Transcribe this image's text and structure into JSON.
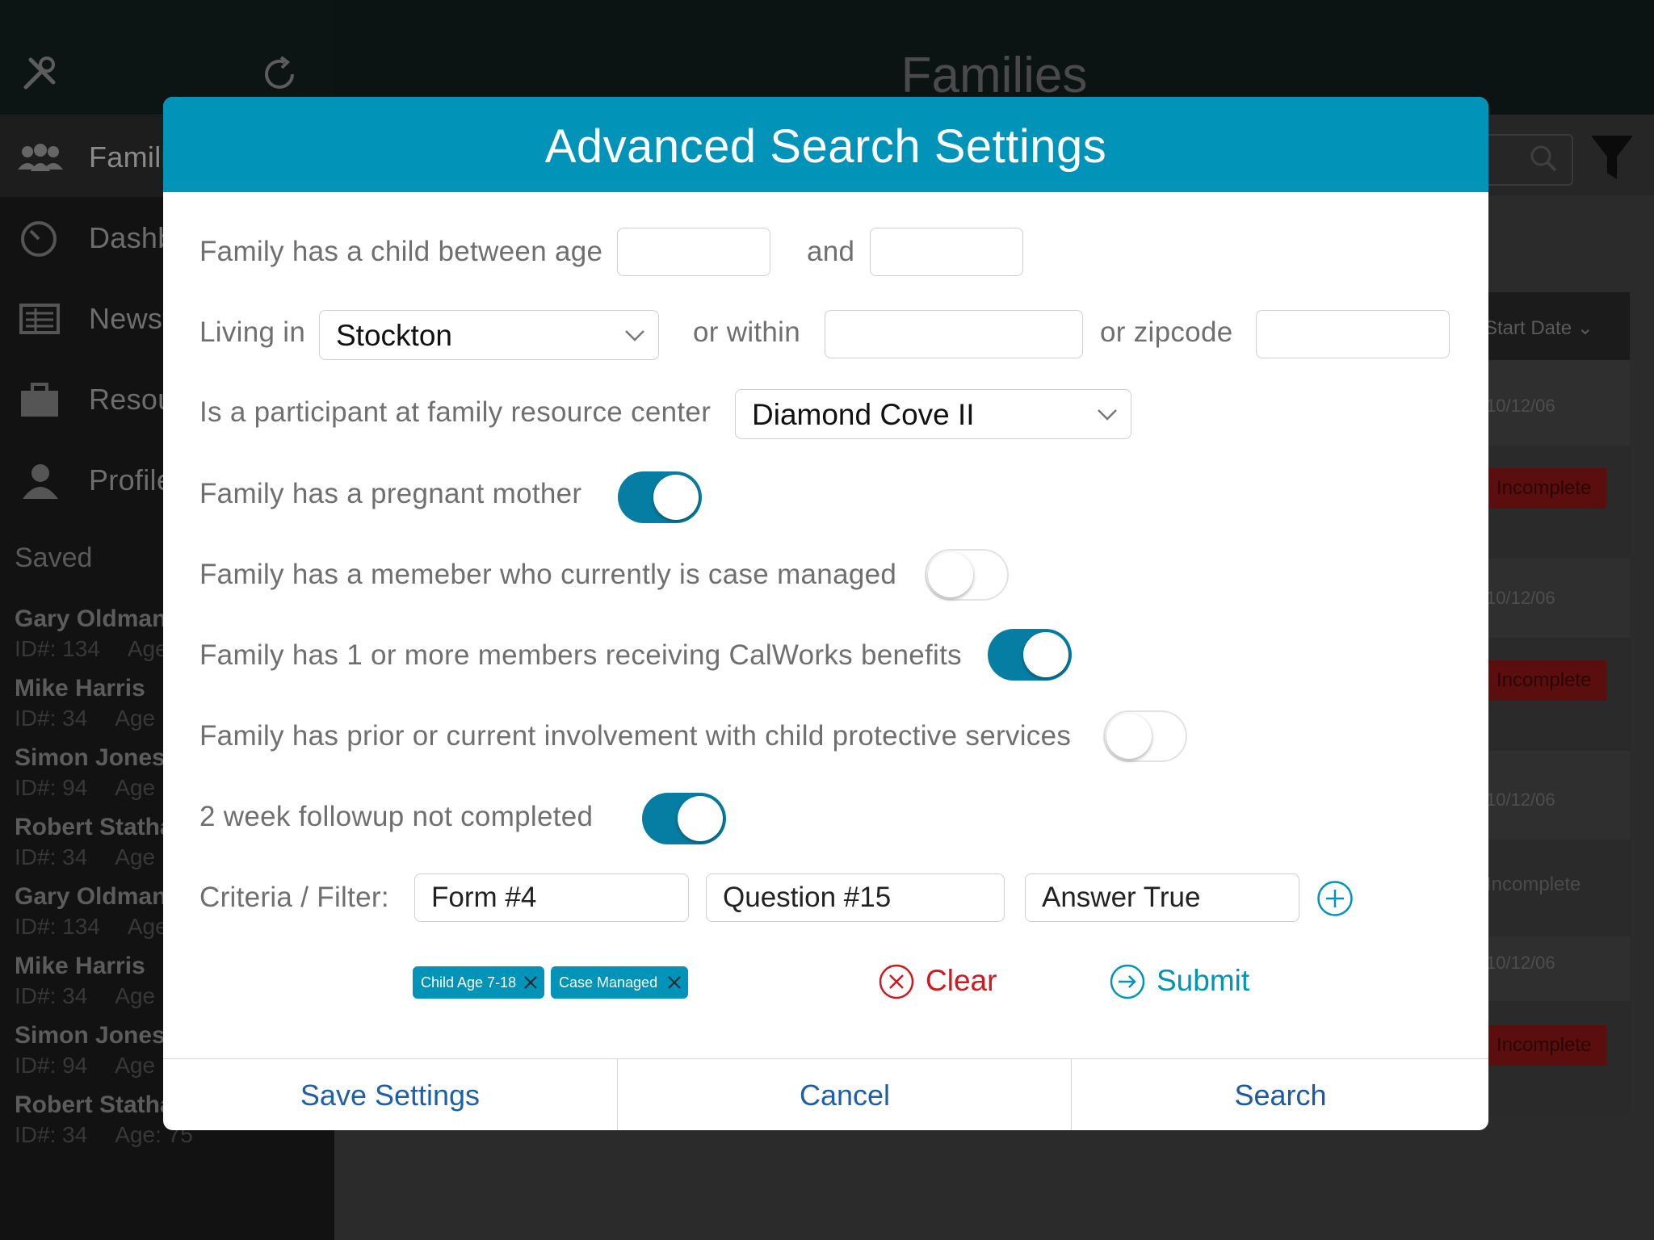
{
  "background": {
    "header_title": "Families",
    "sidebar": {
      "nav": [
        {
          "label": "Families",
          "icon": "people-icon"
        },
        {
          "label": "Dashboard",
          "icon": "dashboard-icon"
        },
        {
          "label": "Newsfeed",
          "icon": "news-icon"
        },
        {
          "label": "Resources",
          "icon": "briefcase-icon"
        },
        {
          "label": "Profile",
          "icon": "person-icon"
        }
      ],
      "saved_heading": "Saved",
      "saved": [
        {
          "name": "Gary Oldman",
          "id": "ID#: 134",
          "age": "Age"
        },
        {
          "name": "Mike Harris",
          "id": "ID#: 34",
          "age": "Age"
        },
        {
          "name": "Simon Jones",
          "id": "ID#: 94",
          "age": "Age"
        },
        {
          "name": "Robert Statham",
          "id": "ID#: 34",
          "age": "Age"
        },
        {
          "name": "Gary Oldman",
          "id": "ID#: 134",
          "age": "Age"
        },
        {
          "name": "Mike Harris",
          "id": "ID#: 34",
          "age": "Age"
        },
        {
          "name": "Simon Jones",
          "id": "ID#: 94",
          "age": "Age"
        },
        {
          "name": "Robert Statham",
          "id": "ID#: 34",
          "age": "Age: 75"
        }
      ]
    },
    "table": {
      "start_date_header": "Start Date",
      "dates": [
        "10/12/06",
        "10/12/06",
        "10/12/06",
        "10/12/06"
      ],
      "status_incomplete": "Incomplete"
    }
  },
  "modal": {
    "title": "Advanced Search Settings",
    "age": {
      "label": "Family has a child between age",
      "and_label": "and",
      "min": "",
      "max": ""
    },
    "location": {
      "living_in_label": "Living in",
      "city": "Stockton",
      "within_label": "or within",
      "within_value": "",
      "zip_label": "or zipcode",
      "zip_value": ""
    },
    "resource_center": {
      "label": "Is a participant at family resource center",
      "value": "Diamond Cove II"
    },
    "toggles": [
      {
        "label": "Family has a pregnant mother",
        "on": true
      },
      {
        "label": "Family has a memeber who currently is case managed",
        "on": false
      },
      {
        "label": "Family has 1 or more members receiving CalWorks benefits",
        "on": true
      },
      {
        "label": "Family has prior or current involvement with child protective services",
        "on": false
      },
      {
        "label": "2 week followup not completed",
        "on": true
      }
    ],
    "criteria": {
      "label": "Criteria / Filter:",
      "form": "Form #4",
      "question": "Question #15",
      "answer": "Answer True"
    },
    "chips": [
      "Child Age 7-18",
      "Case Managed"
    ],
    "clear_label": "Clear",
    "submit_label": "Submit",
    "footer": {
      "save": "Save Settings",
      "cancel": "Cancel",
      "search": "Search"
    },
    "colors": {
      "accent": "#0193b8",
      "toggle_on": "#067ea3",
      "clear": "#d0191f",
      "link": "#1f5fa6"
    }
  }
}
